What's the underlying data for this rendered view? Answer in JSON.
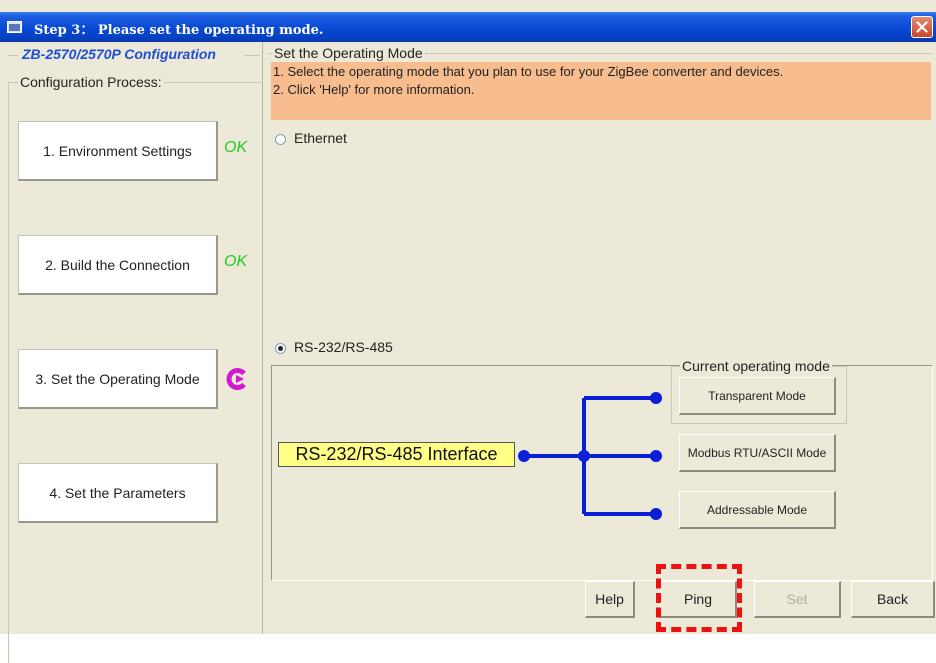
{
  "window": {
    "title": "Step 3： Please set the operating mode."
  },
  "left": {
    "product_title": "ZB-2570/2570P Configuration",
    "process_label": "Configuration Process:",
    "steps": [
      {
        "label": "1. Environment Settings",
        "status": "OK"
      },
      {
        "label": "2. Build the Connection",
        "status": "OK"
      },
      {
        "label": "3. Set the Operating Mode",
        "status": "current-step-arrow"
      },
      {
        "label": "4. Set the Parameters",
        "status": ""
      }
    ]
  },
  "main": {
    "section_label": "Set the Operating Mode",
    "info_lines": [
      "1. Select the operating mode that you plan to use for your ZigBee converter and devices.",
      "2. Click 'Help' for more information."
    ],
    "radio_ethernet": {
      "label": "Ethernet",
      "selected": false
    },
    "radio_serial": {
      "label": "RS-232/RS-485",
      "selected": true
    },
    "interface_label": "RS-232/RS-485 Interface",
    "current_mode_label": "Current operating mode",
    "modes": [
      "Transparent Mode",
      "Modbus RTU/ASCII Mode",
      "Addressable Mode"
    ],
    "current_mode": "Transparent Mode",
    "diagram_color": "#0a1fd6",
    "info_bg": "#f8bd8e"
  },
  "buttons": {
    "help": "Help",
    "ping": "Ping",
    "set": "Set",
    "back": "Back",
    "set_enabled": false
  },
  "highlight": {
    "target": "Ping",
    "color": "#ee1111"
  }
}
